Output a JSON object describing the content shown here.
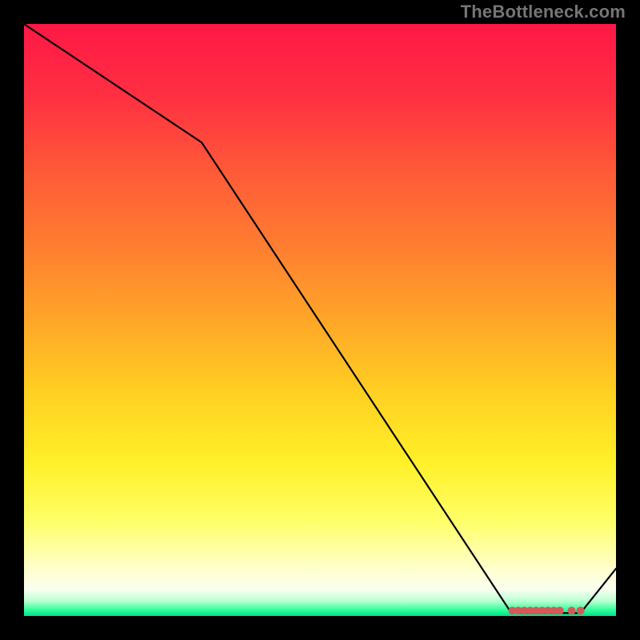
{
  "attribution": "TheBottleneck.com",
  "chart_data": {
    "type": "line",
    "title": "",
    "xlabel": "",
    "ylabel": "",
    "xlim": [
      0,
      100
    ],
    "ylim": [
      0,
      100
    ],
    "series": [
      {
        "name": "curve",
        "x": [
          0,
          30,
          82,
          84,
          86,
          88,
          90,
          92,
          94,
          100
        ],
        "values": [
          100,
          80,
          1,
          0.5,
          0.5,
          0.5,
          0.5,
          0.5,
          0.5,
          8
        ],
        "color": "#000000"
      }
    ],
    "markers": {
      "name": "highlight",
      "x": [
        82.5,
        83.5,
        84.5,
        85.5,
        86.5,
        87.5,
        88.5,
        89.5,
        90.5,
        92.5,
        94.0
      ],
      "values": [
        0.9,
        0.9,
        0.9,
        0.9,
        0.9,
        0.9,
        0.9,
        0.9,
        0.9,
        0.9,
        0.9
      ],
      "color": "#d45a5a",
      "radius": 5
    },
    "background_gradient": {
      "stops": [
        {
          "offset": 0.0,
          "color": "#ff1846"
        },
        {
          "offset": 0.12,
          "color": "#ff2f42"
        },
        {
          "offset": 0.25,
          "color": "#ff5a38"
        },
        {
          "offset": 0.38,
          "color": "#ff7f30"
        },
        {
          "offset": 0.5,
          "color": "#ffa628"
        },
        {
          "offset": 0.62,
          "color": "#ffcf22"
        },
        {
          "offset": 0.74,
          "color": "#fff028"
        },
        {
          "offset": 0.84,
          "color": "#ffff68"
        },
        {
          "offset": 0.91,
          "color": "#ffffc0"
        },
        {
          "offset": 0.955,
          "color": "#fafff0"
        },
        {
          "offset": 0.975,
          "color": "#b8ffd0"
        },
        {
          "offset": 0.99,
          "color": "#2eff9a"
        },
        {
          "offset": 1.0,
          "color": "#00e08a"
        }
      ]
    }
  }
}
